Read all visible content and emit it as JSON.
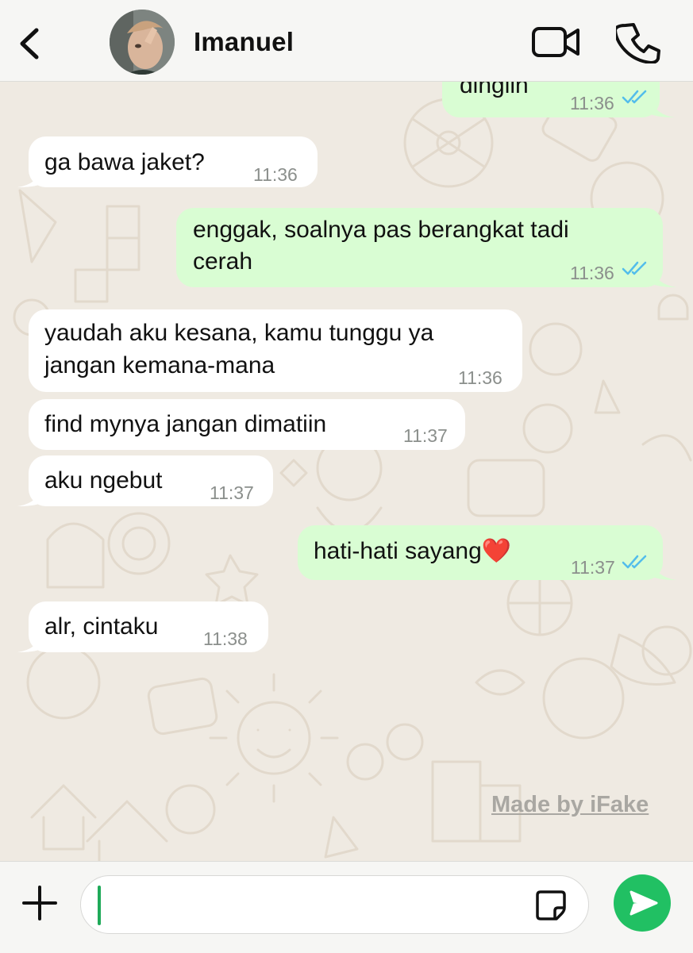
{
  "header": {
    "contact_name": "Imanuel",
    "back_icon": "chevron-left-icon",
    "video_icon": "video-camera-icon",
    "call_icon": "phone-icon"
  },
  "messages": [
    {
      "direction": "outgoing",
      "text": "dingiin",
      "time": "11:36",
      "status": "read"
    },
    {
      "direction": "incoming",
      "text": "ga bawa jaket?",
      "time": "11:36"
    },
    {
      "direction": "outgoing",
      "lines": [
        "enggak, soalnya pas berangkat tadi",
        "cerah"
      ],
      "time": "11:36",
      "status": "read"
    },
    {
      "direction": "incoming",
      "lines": [
        "yaudah aku kesana, kamu tunggu ya",
        "jangan kemana-mana"
      ],
      "time": "11:36"
    },
    {
      "direction": "incoming",
      "text": "find mynya jangan dimatiin",
      "time": "11:37"
    },
    {
      "direction": "incoming",
      "text": "aku ngebut",
      "time": "11:37"
    },
    {
      "direction": "outgoing",
      "text": "hati-hati sayang❤️",
      "time": "11:37",
      "status": "read"
    },
    {
      "direction": "incoming",
      "text": "alr, cintaku",
      "time": "11:38"
    }
  ],
  "watermark": "Made by iFake",
  "input_bar": {
    "message_value": "",
    "plus_icon": "plus-icon",
    "sticker_icon": "sticker-icon",
    "send_icon": "send-icon"
  },
  "colors": {
    "chat_background": "#efeae2",
    "incoming_bubble": "#ffffff",
    "outgoing_bubble": "#d9fdd3",
    "read_ticks": "#53bdeb",
    "send_button": "#21c063"
  }
}
